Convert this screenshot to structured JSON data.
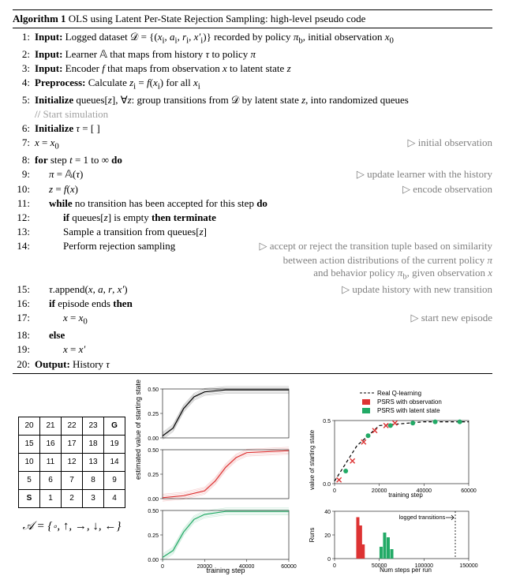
{
  "algo": {
    "number": "Algorithm 1",
    "title": "OLS using Latent Per-State Rejection Sampling: high-level pseudo code",
    "lines": [
      {
        "n": "1:",
        "indent": 0,
        "html": "<b>Input:</b> Logged dataset 𝒟 = {(<i>x</i><sub>i</sub>, <i>a</i><sub>i</sub>, <i>r</i><sub>i</sub>, <i>x′</i><sub>i</sub>)} recorded by policy <i>π</i><sub>b</sub>, initial observation <i>x</i><sub>0</sub>"
      },
      {
        "n": "2:",
        "indent": 0,
        "html": "<b>Input:</b> Learner 𝔸 that maps from history <i>τ</i> to policy <i>π</i>"
      },
      {
        "n": "3:",
        "indent": 0,
        "html": "<b>Input:</b> Encoder <i>f</i> that maps from observation <i>x</i> to latent state <i>z</i>"
      },
      {
        "n": "4:",
        "indent": 0,
        "html": "<b>Preprocess:</b> Calculate <i>z</i><sub>i</sub> = <i>f</i>(<i>x</i><sub>i</sub>) for all <i>x</i><sub>i</sub>"
      },
      {
        "n": "5:",
        "indent": 0,
        "html": "<b>Initialize</b> queues[<i>z</i>], ∀<i>z</i>: group transitions from 𝒟 by latent state <i>z</i>, into randomized queues"
      },
      {
        "n": "",
        "indent": 0,
        "html": "<span style='color:#808080'>// </span><span class='comment-gray'>Start simulation</span>"
      },
      {
        "n": "6:",
        "indent": 0,
        "html": "<b>Initialize</b> <i>τ</i> = [ ]"
      },
      {
        "n": "7:",
        "indent": 0,
        "html": "<i>x</i> = <i>x</i><sub>0</sub>",
        "comment": "▷ initial observation"
      },
      {
        "n": "8:",
        "indent": 0,
        "html": "<b>for</b> step <i>t</i> = 1 to ∞ <b>do</b>"
      },
      {
        "n": "9:",
        "indent": 1,
        "html": "<i>π</i> = 𝔸(<i>τ</i>)",
        "comment": "▷ update learner with the history"
      },
      {
        "n": "10:",
        "indent": 1,
        "html": "<i>z</i> = <i>f</i>(<i>x</i>)",
        "comment": "▷ encode observation"
      },
      {
        "n": "11:",
        "indent": 1,
        "html": "<b>while</b> no transition has been accepted for this step <b>do</b>"
      },
      {
        "n": "12:",
        "indent": 2,
        "html": "<b>if</b> queues[<i>z</i>] is empty <b>then terminate</b>"
      },
      {
        "n": "13:",
        "indent": 2,
        "html": "Sample a transition from queues[<i>z</i>]"
      },
      {
        "n": "14:",
        "indent": 2,
        "html": "Perform rejection sampling",
        "comment": "▷ accept or reject the transition tuple based on similarity"
      },
      {
        "n": "",
        "indent": 0,
        "html": "",
        "extracomment": "between action distributions of the current policy <i>π</i>"
      },
      {
        "n": "",
        "indent": 0,
        "html": "",
        "extracomment": "and behavior policy <i>π</i><sub>b</sub>, given observation <i>x</i>"
      },
      {
        "n": "15:",
        "indent": 1,
        "html": "<i>τ</i>.append(<i>x</i>, <i>a</i>, <i>r</i>, <i>x′</i>)",
        "comment": "▷ update history with new transition"
      },
      {
        "n": "16:",
        "indent": 1,
        "html": "<b>if</b> episode ends <b>then</b>"
      },
      {
        "n": "17:",
        "indent": 2,
        "html": "<i>x</i> = <i>x</i><sub>0</sub>",
        "comment": "▷ start new episode"
      },
      {
        "n": "18:",
        "indent": 1,
        "html": "<b>else</b>"
      },
      {
        "n": "19:",
        "indent": 2,
        "html": "<i>x</i> = <i>x′</i>"
      },
      {
        "n": "20:",
        "indent": 0,
        "html": "<b>Output:</b> History <i>τ</i>"
      }
    ]
  },
  "gridworld": {
    "cells": [
      [
        "20",
        "21",
        "22",
        "23",
        "G"
      ],
      [
        "15",
        "16",
        "17",
        "18",
        "19"
      ],
      [
        "10",
        "11",
        "12",
        "13",
        "14"
      ],
      [
        "5",
        "6",
        "7",
        "8",
        "9"
      ],
      [
        "S",
        "1",
        "2",
        "3",
        "4"
      ]
    ],
    "actions_label": "𝒜 = {∘, ↑, →, ↓, ←}"
  },
  "chart_data": [
    {
      "type": "line",
      "panel": "top-of-3-stack",
      "color": "#000000",
      "x_range": [
        0,
        60000
      ],
      "y_range": [
        0.0,
        0.5
      ],
      "y_ticks": [
        0.0,
        0.25,
        0.5
      ],
      "series": [
        {
          "name": "Real Q-learning",
          "x": [
            0,
            5000,
            10000,
            15000,
            20000,
            30000,
            40000,
            60000
          ],
          "y": [
            0.02,
            0.1,
            0.3,
            0.42,
            0.47,
            0.49,
            0.49,
            0.49
          ]
        }
      ],
      "shared_ylabel": "estimated value of starting state"
    },
    {
      "type": "line",
      "panel": "middle-of-3-stack",
      "color": "#d33",
      "x_range": [
        0,
        60000
      ],
      "y_range": [
        0.0,
        0.5
      ],
      "y_ticks": [
        0.0,
        0.25,
        0.5
      ],
      "series": [
        {
          "name": "PSRS with observation",
          "x": [
            0,
            10000,
            20000,
            25000,
            30000,
            35000,
            40000,
            60000
          ],
          "y": [
            0.01,
            0.03,
            0.08,
            0.18,
            0.32,
            0.42,
            0.47,
            0.49
          ]
        }
      ]
    },
    {
      "type": "line",
      "panel": "bottom-of-3-stack",
      "color": "#2a6",
      "x_range": [
        0,
        60000
      ],
      "y_range": [
        0.0,
        0.5
      ],
      "y_ticks": [
        0.0,
        0.25,
        0.5
      ],
      "x_ticks": [
        0,
        20000,
        40000,
        60000
      ],
      "xlabel": "training step",
      "series": [
        {
          "name": "PSRS with latent state",
          "x": [
            0,
            5000,
            10000,
            15000,
            20000,
            30000,
            40000,
            60000
          ],
          "y": [
            0.02,
            0.09,
            0.28,
            0.41,
            0.46,
            0.49,
            0.49,
            0.49
          ]
        }
      ]
    },
    {
      "type": "line",
      "panel": "right-top",
      "legend": [
        {
          "name": "Real Q-learning",
          "style": "dashed",
          "color": "#000"
        },
        {
          "name": "PSRS with observation",
          "style": "solid",
          "color": "#d33"
        },
        {
          "name": "PSRS with latent state",
          "style": "solid",
          "color": "#2a6"
        }
      ],
      "x_range": [
        0,
        60000
      ],
      "y_range": [
        0.0,
        0.5
      ],
      "x_ticks": [
        0,
        20000,
        40000,
        60000
      ],
      "y_ticks": [
        0.0,
        0.5
      ],
      "xlabel": "training step",
      "ylabel": "value of starting state",
      "series": [
        {
          "name": "Real Q-learning",
          "x": [
            0,
            10000,
            20000,
            40000,
            60000
          ],
          "y": [
            0.02,
            0.3,
            0.46,
            0.49,
            0.49
          ]
        },
        {
          "name": "PSRS with observation",
          "marker": "x",
          "x": [
            2000,
            8000,
            13000,
            18000,
            23000,
            27000
          ],
          "y": [
            0.03,
            0.18,
            0.33,
            0.42,
            0.46,
            0.48
          ]
        },
        {
          "name": "PSRS with latent state",
          "marker": "o",
          "x": [
            5000,
            15000,
            25000,
            35000,
            45000,
            56000
          ],
          "y": [
            0.1,
            0.38,
            0.46,
            0.48,
            0.49,
            0.49
          ]
        }
      ]
    },
    {
      "type": "bar",
      "panel": "right-bottom",
      "xlabel": "Num steps per run",
      "ylabel": "Runs",
      "x_range": [
        0,
        150000
      ],
      "y_range": [
        0,
        40
      ],
      "x_ticks": [
        0,
        50000,
        100000,
        150000
      ],
      "y_ticks": [
        0,
        20,
        40
      ],
      "annotation": {
        "text": "logged transitions",
        "x": 135000,
        "style": "arrow_right",
        "line_x": 135000
      },
      "series": [
        {
          "name": "PSRS with observation",
          "color": "#d33",
          "bins": [
            {
              "x": 26000,
              "h": 35
            },
            {
              "x": 29000,
              "h": 28
            },
            {
              "x": 32000,
              "h": 12
            }
          ]
        },
        {
          "name": "PSRS with latent state",
          "color": "#2a6",
          "bins": [
            {
              "x": 52000,
              "h": 10
            },
            {
              "x": 56000,
              "h": 22
            },
            {
              "x": 60000,
              "h": 18
            },
            {
              "x": 64000,
              "h": 8
            }
          ]
        }
      ]
    }
  ],
  "labels": {
    "training_step": "training step",
    "est_value": "estimated value of starting state",
    "value_starting": "value of starting state",
    "runs": "Runs",
    "num_steps": "Num steps per run",
    "logged_transitions": "logged transitions",
    "legend_real": "Real Q-learning",
    "legend_obs": "PSRS with observation",
    "legend_latent": "PSRS with latent state"
  }
}
